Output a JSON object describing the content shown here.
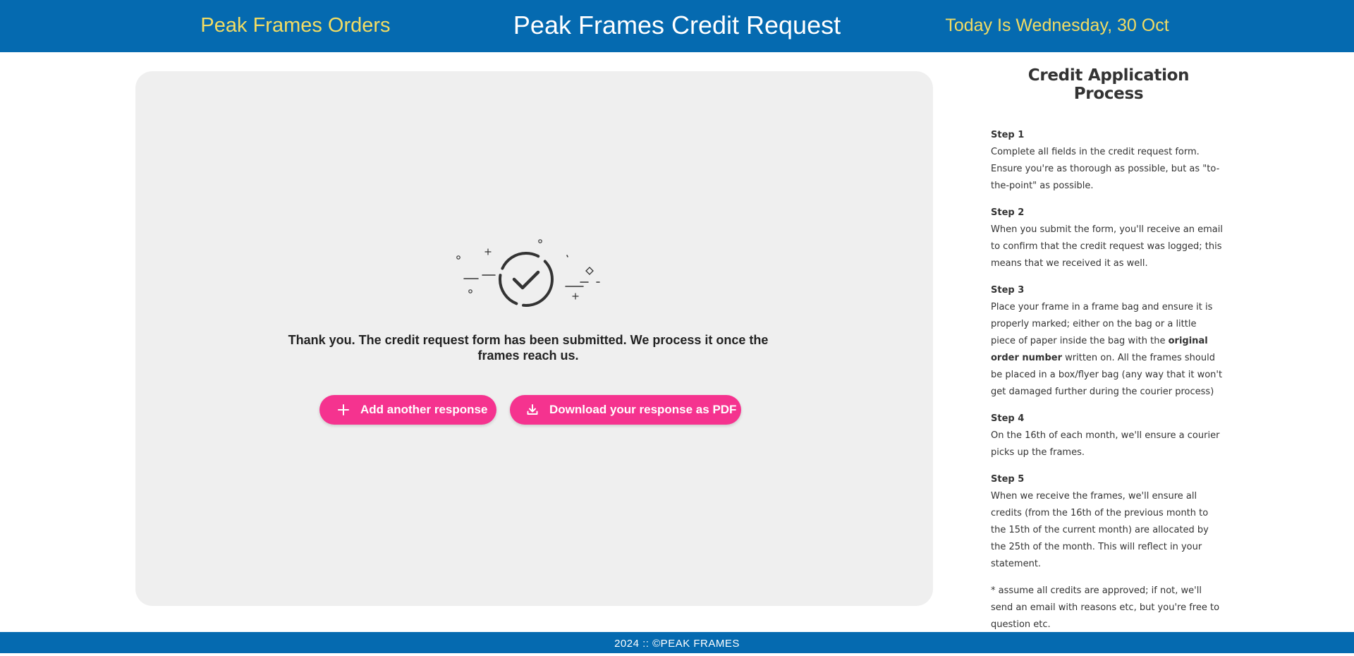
{
  "header": {
    "left_link": "Peak Frames Orders",
    "title": "Peak Frames Credit Request",
    "date_text": "Today Is Wednesday, 30 Oct"
  },
  "confirmation": {
    "icon": "check-circle-icon",
    "message": "Thank you. The credit request form has been submitted. We process it once the frames reach us.",
    "add_button": {
      "label": "Add another response",
      "icon": "plus-icon"
    },
    "pdf_button": {
      "label": "Download your response as PDF",
      "icon": "download-icon"
    }
  },
  "sidebar": {
    "title": "Credit Application Process",
    "steps": [
      {
        "title": "Step 1",
        "text": "Complete all fields in the credit request form. Ensure you're as thorough as possible, but as \"to-the-point\" as possible."
      },
      {
        "title": "Step 2",
        "text": "When you submit the form, you'll receive an email to confirm that the credit request was logged; this means that we received it as well."
      },
      {
        "title": "Step 3",
        "text_before": "Place your frame in a frame bag and ensure it is properly marked; either on the bag or a little piece of paper inside the bag with the ",
        "bold": "original order number",
        "text_after": " written on. All the frames should be placed in a box/flyer bag (any way that it won't get damaged further during the courier process)"
      },
      {
        "title": "Step 4",
        "text": "On the 16th of each month, we'll ensure a courier picks up the frames."
      },
      {
        "title": "Step 5",
        "text": "When we receive the frames, we'll ensure all credits (from the 16th of the previous month to the 15th of the current month) are allocated by the 25th of the month. This will reflect in your statement."
      }
    ],
    "note": "* assume all credits are approved; if not, we'll send an email with reasons etc, but you're free to question etc."
  },
  "footer": {
    "text": "2024 :: ©PEAK FRAMES"
  },
  "colors": {
    "header_bg": "#056ab0",
    "accent_yellow": "#f2dc63",
    "button_pink": "#f5338f",
    "panel_bg": "#efefef"
  }
}
